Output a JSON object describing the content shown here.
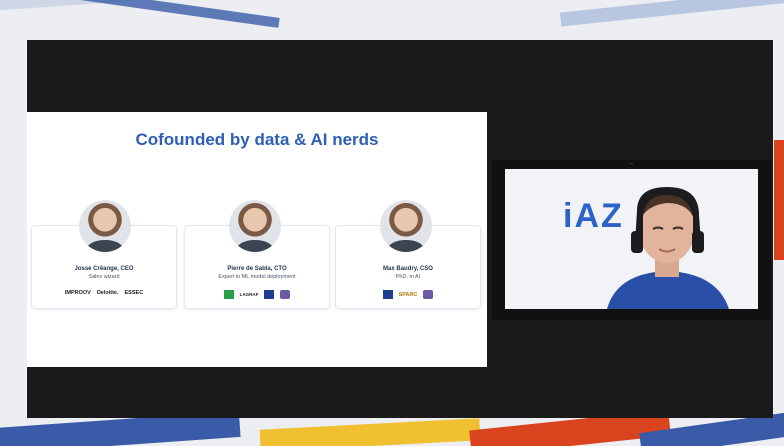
{
  "slide": {
    "title": "Cofounded by data & AI nerds",
    "people": [
      {
        "name": "Josse Crêange, CEO",
        "role": "Sales wizard",
        "logos": [
          "IMPROOV",
          "Deloitte.",
          "ESSEC"
        ]
      },
      {
        "name": "Pierre de Sabla, CTO",
        "role": "Expert in ML model deployment",
        "logos": [
          "LAGRAF"
        ]
      },
      {
        "name": "Max Baudry, CSO",
        "role": "PhD. in AI",
        "logos": [
          "SPARC"
        ]
      }
    ]
  },
  "camera": {
    "top_text": "...",
    "brand": "iAZ",
    "label": ""
  },
  "colors": {
    "title": "#2e5fb5",
    "frame": "#1a1a1a",
    "brand": "#2d63c8"
  }
}
